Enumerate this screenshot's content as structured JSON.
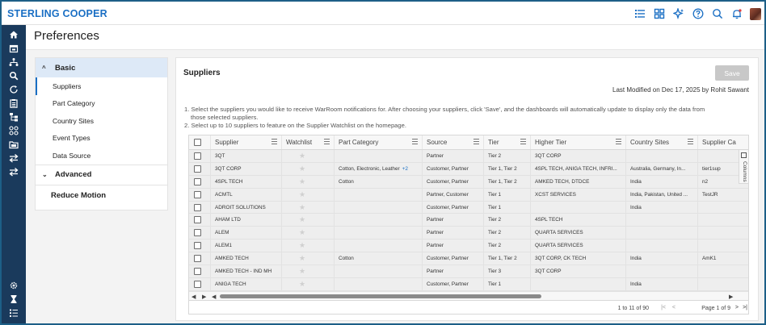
{
  "app": {
    "brand": "STERLING COOPER"
  },
  "topbar": {
    "icons": [
      "list-icon",
      "grid-icon",
      "sparkle-icon",
      "help-icon",
      "search-icon",
      "bell-icon",
      "avatar"
    ]
  },
  "nav": {
    "icons": [
      "home-icon",
      "calendar-icon",
      "network-icon",
      "search-icon",
      "refresh-icon",
      "clipboard-icon",
      "hierarchy-icon",
      "apps-icon",
      "folders-icon",
      "transfer-icon",
      "swap-icon",
      "settings-icon",
      "hourglass-icon",
      "checklist-icon"
    ]
  },
  "page": {
    "title": "Preferences"
  },
  "sidebar": {
    "basic": {
      "label": "Basic",
      "items": [
        {
          "label": "Suppliers"
        },
        {
          "label": "Part Category"
        },
        {
          "label": "Country Sites"
        },
        {
          "label": "Event Types"
        },
        {
          "label": "Data Source"
        }
      ]
    },
    "advanced": {
      "label": "Advanced"
    },
    "reduce_motion": {
      "label": "Reduce Motion"
    }
  },
  "main": {
    "title": "Suppliers",
    "save_label": "Save",
    "last_modified": "Last Modified on Dec 17, 2025 by Rohit Sawant",
    "instructions": [
      "1. Select the suppliers you would like to receive WarRoom notifications for. After choosing your suppliers, click 'Save', and the dashboards will automatically update to display only the data from",
      "those selected suppliers.",
      "2. Select up to 10 suppliers to feature on the Supplier Watchlist on the homepage."
    ]
  },
  "grid": {
    "columns": [
      "Supplier",
      "Watchlist",
      "Part Category",
      "Source",
      "Tier",
      "Higher Tier",
      "Country Sites",
      "Supplier Ca"
    ],
    "columns_tab_label": "Columns",
    "rows": [
      {
        "supplier": "3QT",
        "part_category": "",
        "more": "",
        "source": "Partner",
        "tier": "Tier 2",
        "higher_tier": "3QT CORP",
        "country_sites": "",
        "supplier_ca": ""
      },
      {
        "supplier": "3QT CORP",
        "part_category": "Cotton, Electronic, Leather",
        "more": "+2",
        "source": "Customer, Partner",
        "tier": "Tier 1, Tier 2",
        "higher_tier": "4SPL TECH, ANIGA TECH, INFRI...",
        "country_sites": "Australia, Germany, In...",
        "supplier_ca": "tier1sup"
      },
      {
        "supplier": "4SPL TECH",
        "part_category": "Cotton",
        "more": "",
        "source": "Customer, Partner",
        "tier": "Tier 1, Tier 2",
        "higher_tier": "AMKED TECH, DTDCE",
        "country_sites": "India",
        "supplier_ca": "n2"
      },
      {
        "supplier": "ACMTL",
        "part_category": "",
        "more": "",
        "source": "Partner, Customer",
        "tier": "Tier 1",
        "higher_tier": "XCST SERVICES",
        "country_sites": "India, Pakistan, United ...",
        "supplier_ca": "TestJR"
      },
      {
        "supplier": "ADROIT SOLUTIONS",
        "part_category": "",
        "more": "",
        "source": "Customer, Partner",
        "tier": "Tier 1",
        "higher_tier": "",
        "country_sites": "India",
        "supplier_ca": ""
      },
      {
        "supplier": "AHAM LTD",
        "part_category": "",
        "more": "",
        "source": "Partner",
        "tier": "Tier 2",
        "higher_tier": "4SPL TECH",
        "country_sites": "",
        "supplier_ca": ""
      },
      {
        "supplier": "ALEM",
        "part_category": "",
        "more": "",
        "source": "Partner",
        "tier": "Tier 2",
        "higher_tier": "QUARTA SERVICES",
        "country_sites": "",
        "supplier_ca": ""
      },
      {
        "supplier": "ALEM1",
        "part_category": "",
        "more": "",
        "source": "Partner",
        "tier": "Tier 2",
        "higher_tier": "QUARTA SERVICES",
        "country_sites": "",
        "supplier_ca": ""
      },
      {
        "supplier": "AMKED TECH",
        "part_category": "Cotton",
        "more": "",
        "source": "Customer, Partner",
        "tier": "Tier 1, Tier 2",
        "higher_tier": "3QT CORP, CK TECH",
        "country_sites": "India",
        "supplier_ca": "AmK1"
      },
      {
        "supplier": "AMKED TECH - IND MH",
        "part_category": "",
        "more": "",
        "source": "Partner",
        "tier": "Tier 3",
        "higher_tier": "3QT CORP",
        "country_sites": "",
        "supplier_ca": ""
      },
      {
        "supplier": "ANIGA TECH",
        "part_category": "",
        "more": "",
        "source": "Customer, Partner",
        "tier": "Tier 1",
        "higher_tier": "",
        "country_sites": "India",
        "supplier_ca": ""
      }
    ]
  },
  "pagination": {
    "count": "1 to 11 of 90",
    "page_label": "Page 1 of 9"
  },
  "colors": {
    "brand": "#1a6fc4",
    "nav_bg": "#1a3a5c",
    "frame_border": "#1d5f87",
    "save_disabled": "#c8c8c8",
    "active_section": "#dde9f7"
  }
}
